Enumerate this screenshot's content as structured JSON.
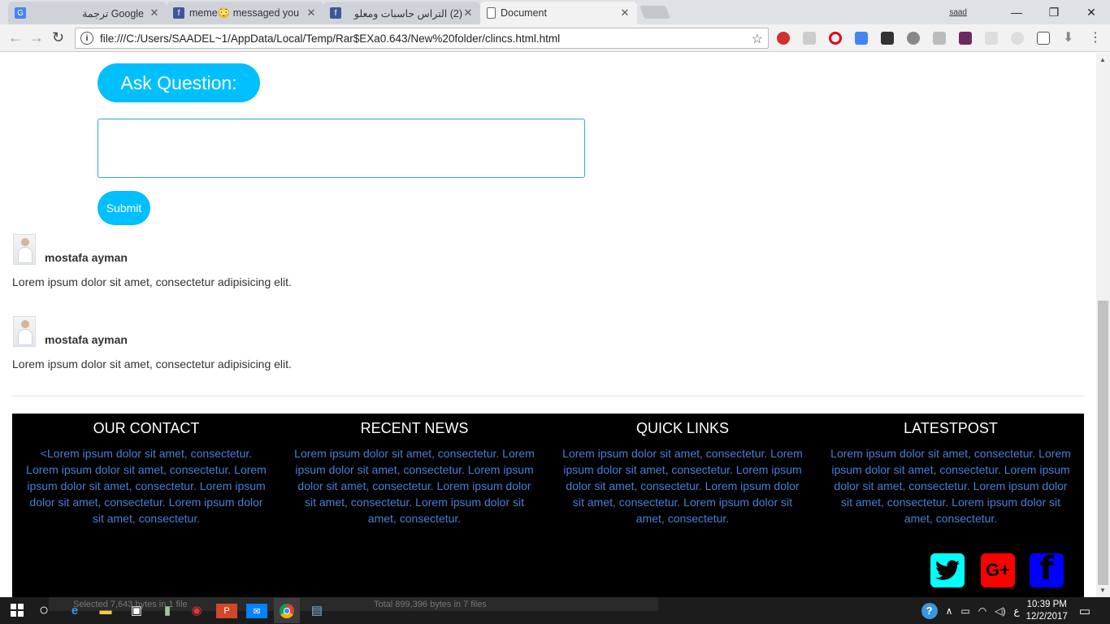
{
  "browser": {
    "tabs": [
      {
        "title": "ترجمة Google",
        "icon": "google-translate-icon"
      },
      {
        "title": "meme😳 messaged you",
        "icon": "facebook-icon"
      },
      {
        "title": "(2) التراس حاسبات ومعلو",
        "icon": "facebook-icon"
      },
      {
        "title": "Document",
        "icon": "document-icon"
      }
    ],
    "profile_name": "saad",
    "url": "file:///C:/Users/SAADEL~1/AppData/Local/Temp/Rar$EXa0.643/New%20folder/clincs.html.html"
  },
  "page": {
    "ask_label": "Ask Question:",
    "question_value": "",
    "submit_label": "Submit",
    "comments": [
      {
        "name": "mostafa ayman",
        "text": "Lorem ipsum dolor sit amet, consectetur adipisicing elit."
      },
      {
        "name": "mostafa ayman",
        "text": "Lorem ipsum dolor sit amet, consectetur adipisicing elit."
      }
    ]
  },
  "footer": {
    "columns": [
      {
        "title": "OUR CONTACT",
        "text": "<Lorem ipsum dolor sit amet, consectetur. Lorem ipsum dolor sit amet, consectetur. Lorem ipsum dolor sit amet, consectetur. Lorem ipsum dolor sit amet, consectetur. Lorem ipsum dolor sit amet, consectetur."
      },
      {
        "title": "RECENT NEWS",
        "text": "Lorem ipsum dolor sit amet, consectetur. Lorem ipsum dolor sit amet, consectetur. Lorem ipsum dolor sit amet, consectetur. Lorem ipsum dolor sit amet, consectetur. Lorem ipsum dolor sit amet, consectetur."
      },
      {
        "title": "QUICK LINKS",
        "text": "Lorem ipsum dolor sit amet, consectetur. Lorem ipsum dolor sit amet, consectetur. Lorem ipsum dolor sit amet, consectetur. Lorem ipsum dolor sit amet, consectetur. Lorem ipsum dolor sit amet, consectetur."
      },
      {
        "title": "LATESTPOST",
        "text": "Lorem ipsum dolor sit amet, consectetur. Lorem ipsum dolor sit amet, consectetur. Lorem ipsum dolor sit amet, consectetur. Lorem ipsum dolor sit amet, consectetur. Lorem ipsum dolor sit amet, consectetur."
      }
    ],
    "social": [
      {
        "name": "twitter-icon",
        "color": "#00ffff"
      },
      {
        "name": "google-plus-icon",
        "color": "#ff0000",
        "glyph": "G+"
      },
      {
        "name": "facebook-icon",
        "color": "#0000ff"
      }
    ]
  },
  "colors": {
    "accent": "#00bfff",
    "footer_text": "#4a7fd4"
  },
  "taskbar": {
    "explorer_selected": "Selected 7,643 bytes in 1 file",
    "explorer_total": "Total 899,396 bytes in 7 files",
    "keyboard_lang": "ع",
    "time": "10:39 PM",
    "date": "12/2/2017"
  }
}
